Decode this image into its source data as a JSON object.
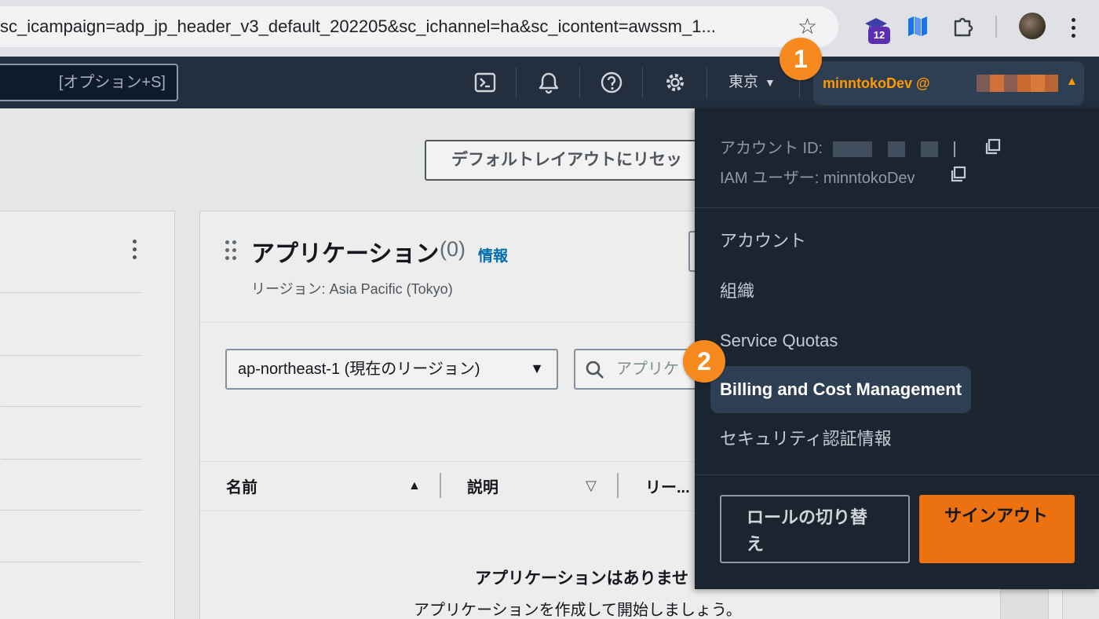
{
  "browser": {
    "url": "sc_icampaign=adp_jp_header_v3_default_202205&sc_ichannel=ha&sc_icontent=awssm_1...",
    "extension_badge": "12",
    "icons": [
      "star-icon",
      "graduation-cap-icon",
      "map-icon",
      "puzzle-icon",
      "profile-avatar",
      "more-vert-icon"
    ]
  },
  "aws_nav": {
    "search_shortcut": "[オプション+S]",
    "region": "東京",
    "account_name": "minntokoDev @",
    "icons": [
      "cloudshell-icon",
      "bell-icon",
      "help-icon",
      "gear-icon"
    ],
    "accent_color": "#ff9900"
  },
  "console": {
    "reset_layout_button": "デフォルトレイアウトにリセッ",
    "app_panel": {
      "title": "アプリケーション",
      "count": "(0)",
      "info_link": "情報",
      "region_line": "リージョン: Asia Pacific (Tokyo)",
      "region_select": "ap-northeast-1 (現在のリージョン)",
      "search_placeholder": "アプリケ",
      "columns": [
        "名前",
        "説明",
        "リー..."
      ],
      "empty_title": "アプリケーションはありませ",
      "empty_sub": "アプリケーションを作成して開始しましょう。"
    }
  },
  "account_menu": {
    "account_id_label": "アカウント ID:",
    "iam_user": "IAM ユーザー: minntokoDev",
    "items": [
      {
        "label": "アカウント"
      },
      {
        "label": "組織"
      },
      {
        "label": "Service Quotas"
      },
      {
        "label": "Billing and Cost Management",
        "active": true
      },
      {
        "label": "セキュリティ認証情報"
      }
    ],
    "switch_role_button": "ロールの切り替え",
    "sign_out_button": "サインアウト"
  },
  "callouts": {
    "step1": "1",
    "step2": "2",
    "color": "#f68a1e"
  }
}
